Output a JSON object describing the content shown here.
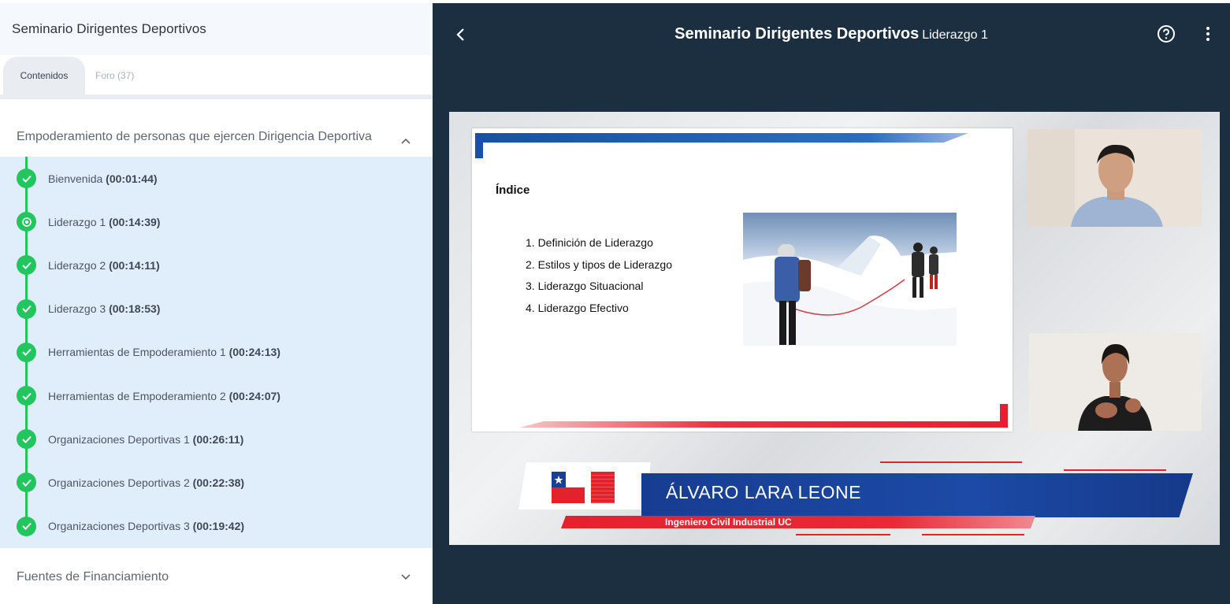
{
  "sidebar": {
    "title": "Seminario Dirigentes Deportivos",
    "tabs": [
      {
        "label": "Contenidos"
      },
      {
        "label": "Foro (37)"
      }
    ],
    "sections": [
      {
        "title": "Empoderamiento de personas que ejercen Dirigencia Deportiva",
        "expanded": true,
        "items": [
          {
            "name": "Bienvenida",
            "duration": "(00:01:44)",
            "status": "completed"
          },
          {
            "name": "Liderazgo 1",
            "duration": "(00:14:39)",
            "status": "current"
          },
          {
            "name": "Liderazgo 2",
            "duration": "(00:14:11)",
            "status": "completed"
          },
          {
            "name": "Liderazgo 3",
            "duration": "(00:18:53)",
            "status": "completed"
          },
          {
            "name": "Herramientas de Empoderamiento 1",
            "duration": "(00:24:13)",
            "status": "completed"
          },
          {
            "name": "Herramientas de Empoderamiento 2",
            "duration": "(00:24:07)",
            "status": "completed"
          },
          {
            "name": "Organizaciones Deportivas 1",
            "duration": "(00:26:11)",
            "status": "completed"
          },
          {
            "name": "Organizaciones Deportivas 2",
            "duration": "(00:22:38)",
            "status": "completed"
          },
          {
            "name": "Organizaciones Deportivas 3",
            "duration": "(00:19:42)",
            "status": "completed"
          }
        ]
      },
      {
        "title": "Fuentes de Financiamiento",
        "expanded": false
      }
    ]
  },
  "player": {
    "title": "Seminario Dirigentes Deportivos",
    "subtitle": "Liderazgo 1",
    "icons": {
      "back": "chevron-left-icon",
      "help": "help-circle-icon",
      "more": "more-vertical-icon"
    }
  },
  "slide": {
    "heading": "Índice",
    "list": [
      "1. Definición de Liderazgo",
      "2. Estilos y tipos de Liderazgo",
      "3. Liderazgo Situacional",
      "4. Liderazgo Efectivo"
    ]
  },
  "lower_third": {
    "name": "ÁLVARO LARA LEONE",
    "role": "Ingeniero Civil Industrial UC"
  },
  "colors": {
    "sidebar_bg": "#f5f8fd",
    "list_bg": "#e0eefc",
    "accent_green": "#22c55e",
    "player_bg": "#1c2f40",
    "brand_blue": "#1c4aa6",
    "brand_red": "#e3222c"
  }
}
